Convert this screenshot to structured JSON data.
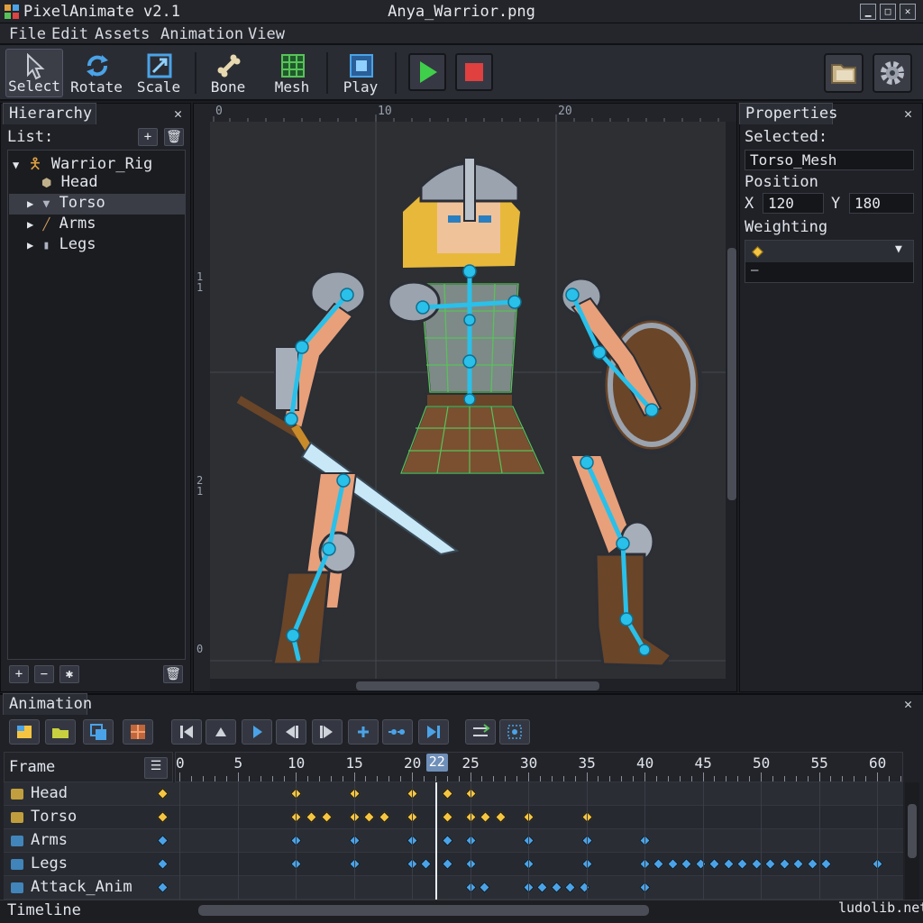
{
  "window": {
    "app_title": "PixelAnimate v2.1",
    "file_title": "Anya_Warrior.png",
    "min": "▁",
    "max": "□",
    "close": "✕"
  },
  "menu": [
    "File",
    "Edit",
    "Assets",
    "Animation",
    "View"
  ],
  "toolbar": {
    "tools": [
      "Select",
      "Rotate",
      "Scale",
      "Bone",
      "Mesh",
      "Play"
    ]
  },
  "hierarchy": {
    "tab": "Hierarchy",
    "list_label": "List:",
    "items": [
      "Warrior_Rig",
      "Head",
      "Torso",
      "Arms",
      "Legs"
    ]
  },
  "ruler": {
    "top": [
      "0",
      "10",
      "20"
    ],
    "left": [
      "1\n1",
      "2\n1",
      "0"
    ]
  },
  "properties": {
    "tab": "Properties",
    "selected_label": "Selected:",
    "selected_value": "Torso_Mesh",
    "position_label": "Position",
    "x_label": "X",
    "x_value": "120",
    "y_label": "Y",
    "y_value": "180",
    "weighting_label": "Weighting",
    "weighting_value": "—"
  },
  "animation": {
    "tab": "Animation",
    "frame_label": "Frame",
    "current_frame": "22",
    "frame_ticks": [
      "0",
      "5",
      "10",
      "15",
      "20",
      "25",
      "30",
      "35",
      "40",
      "45",
      "50",
      "55",
      "60"
    ],
    "tracks": [
      {
        "name": "Head",
        "color": "#f5c542",
        "keys": [
          10,
          15,
          20,
          23,
          25
        ]
      },
      {
        "name": "Torso",
        "color": "#f5c542",
        "keys": [
          10,
          11.3,
          12.6,
          15,
          16.3,
          17.6,
          20,
          23,
          25,
          26.3,
          27.6,
          30,
          35
        ]
      },
      {
        "name": "Arms",
        "color": "#4aa3e8",
        "keys": [
          10,
          15,
          20,
          23,
          25,
          30,
          35,
          40
        ]
      },
      {
        "name": "Legs",
        "color": "#4aa3e8",
        "keys": [
          10,
          15,
          20,
          21.2,
          23,
          25,
          30,
          35,
          40,
          41.2,
          42.4,
          43.6,
          44.8,
          46,
          47.2,
          48.4,
          49.6,
          50.8,
          52,
          53.2,
          54.4,
          55.6,
          60
        ]
      },
      {
        "name": "Attack_Anim",
        "color": "#4aa3e8",
        "keys": [
          25,
          26.2,
          30,
          31.2,
          32.4,
          33.6,
          34.8,
          40
        ]
      }
    ],
    "timeline_label": "Timeline"
  },
  "watermark": "ludolib.net"
}
